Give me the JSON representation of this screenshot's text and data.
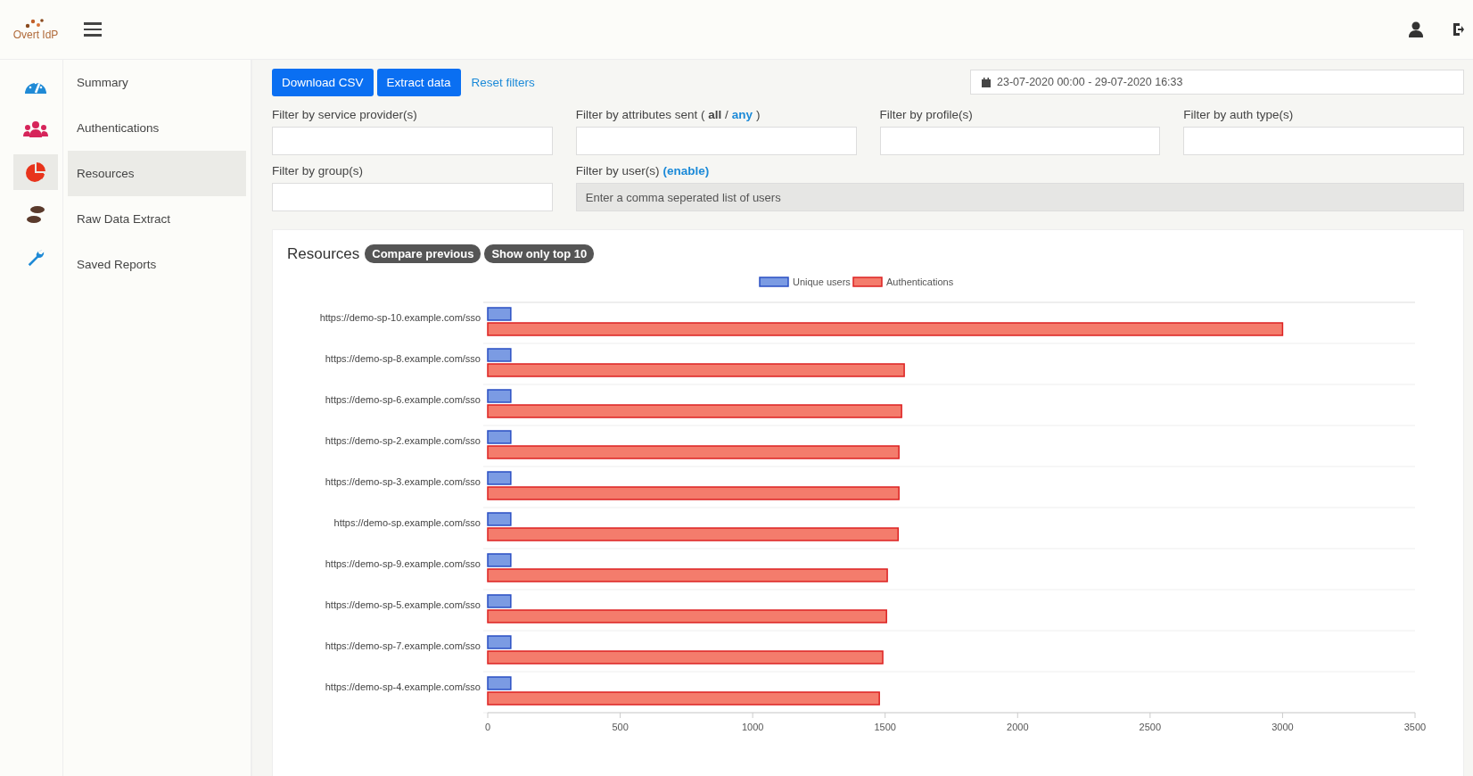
{
  "logo": {
    "text": "Overt IdP"
  },
  "icon_bar": [
    {
      "kind": "gauge",
      "selected": false
    },
    {
      "kind": "users",
      "selected": false
    },
    {
      "kind": "pie",
      "selected": true
    },
    {
      "kind": "footprints",
      "selected": false
    },
    {
      "kind": "wrench",
      "selected": false
    }
  ],
  "sidebar": {
    "items": [
      {
        "label": "Summary",
        "selected": false
      },
      {
        "label": "Authentications",
        "selected": false
      },
      {
        "label": "Resources",
        "selected": true
      },
      {
        "label": "Raw Data Extract",
        "selected": false
      },
      {
        "label": "Saved Reports",
        "selected": false
      }
    ]
  },
  "toolbar": {
    "buttons": [
      "Download CSV",
      "Extract data"
    ],
    "link": "Reset filters",
    "date_range": "23-07-2020 00:00 - 29-07-2020 16:33"
  },
  "filters": [
    {
      "label": "Filter by service provider(s)",
      "disabled": false
    },
    {
      "label": "Filter by attributes sent ( **all** /",
      "link": "any",
      "suffix": ")",
      "disabled": false
    },
    {
      "label": "Filter by profile(s)",
      "disabled": false
    },
    {
      "label": "Filter by auth type(s)",
      "disabled": false
    },
    {
      "label": "Filter by group(s)",
      "disabled": false
    },
    {
      "label": "Filter by user(s)",
      "link": "(enable)",
      "disabled": true,
      "placeholder": "Enter a comma seperated list of users"
    }
  ],
  "panel": {
    "title": "Resources",
    "badges": [
      "Compare previous",
      "Show only top 10"
    ],
    "chart_data": {
      "type": "bar",
      "orientation": "horizontal",
      "legend": "top",
      "categories": [
        "https://demo-sp-10.example.com/sso",
        "https://demo-sp-8.example.com/sso",
        "https://demo-sp-6.example.com/sso",
        "https://demo-sp-2.example.com/sso",
        "https://demo-sp-3.example.com/sso",
        "https://demo-sp.example.com/sso",
        "https://demo-sp-9.example.com/sso",
        "https://demo-sp-5.example.com/sso",
        "https://demo-sp-7.example.com/sso",
        "https://demo-sp-4.example.com/sso"
      ],
      "series": [
        {
          "name": "Unique users",
          "color": "#7b9be3",
          "values": [
            87,
            87,
            87,
            87,
            87,
            87,
            87,
            87,
            87,
            87
          ]
        },
        {
          "name": "Authentications",
          "color": "#f47c6c",
          "values": [
            3000,
            1572,
            1562,
            1552,
            1552,
            1549,
            1508,
            1505,
            1491,
            1478
          ]
        }
      ],
      "xlim": [
        0,
        3500
      ],
      "xticks": [
        0,
        500,
        1000,
        1500,
        2000,
        2500,
        3000,
        3500
      ]
    }
  }
}
